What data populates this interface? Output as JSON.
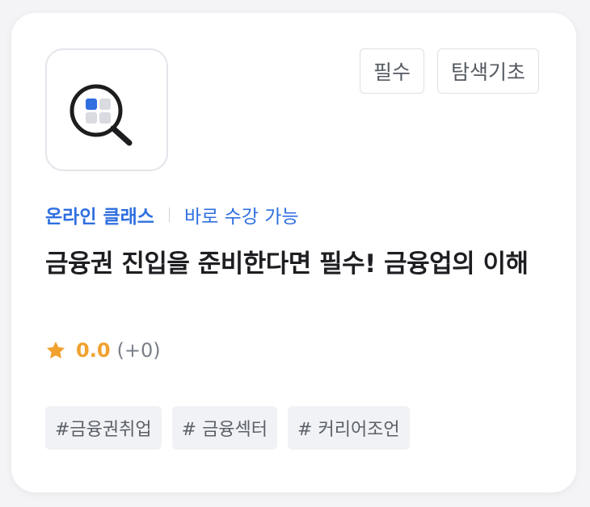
{
  "course": {
    "badges": [
      "필수",
      "탐색기초"
    ],
    "category": "온라인 클래스",
    "availability": "바로 수강 가능",
    "title": "금융권 진입을 준비한다면 필수! 금융업의 이해",
    "rating": {
      "score": "0.0",
      "count": "(+0)"
    },
    "hashtags": [
      "#금융권취업",
      "# 금융섹터",
      "# 커리어조언"
    ],
    "thumbnail_icon": "magnifier-grid-icon"
  },
  "colors": {
    "accent": "#2f6fe0",
    "star": "#f0a12e",
    "title": "#1e1e22"
  }
}
